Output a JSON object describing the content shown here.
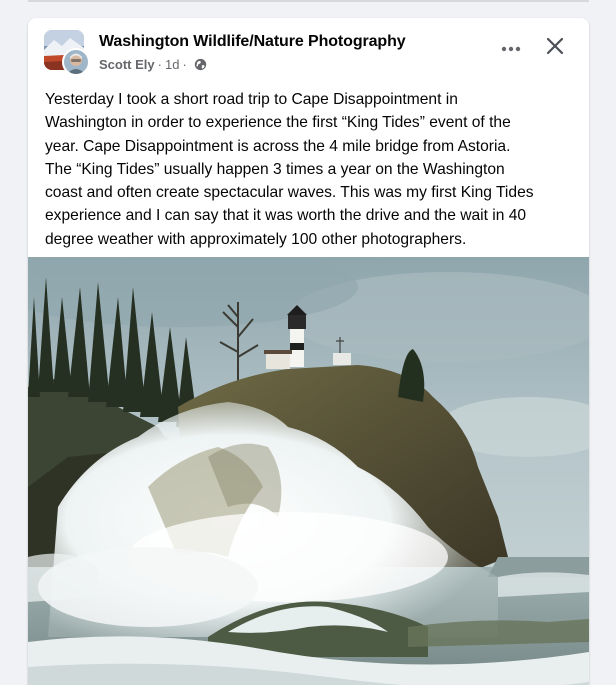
{
  "post": {
    "group_name": "Washington Wildlife/Nature Photography",
    "author": "Scott Ely",
    "separator": "·",
    "time": "1d",
    "audience_icon": "globe-icon",
    "body_lines": [
      "Yesterday I took a short road trip to Cape Disappointment in",
      "Washington in order to experience the first “King Tides” event of the",
      "year. Cape Disappointment is across the 4 mile bridge from Astoria.",
      "The “King Tides” usually happen 3 times a year on the Washington",
      "coast and often create spectacular waves. This was my first King Tides",
      "experience and I can say that it was worth the drive and the wait in 40",
      "degree weather with approximately 100 other photographers."
    ],
    "actions": {
      "more_icon": "more-horizontal-icon",
      "close_icon": "close-icon"
    },
    "photo_icon": "lighthouse-wave-photo"
  },
  "colors": {
    "card_bg": "#ffffff",
    "page_bg": "#f0f2f5",
    "primary_text": "#050505",
    "secondary_text": "#65676b"
  }
}
